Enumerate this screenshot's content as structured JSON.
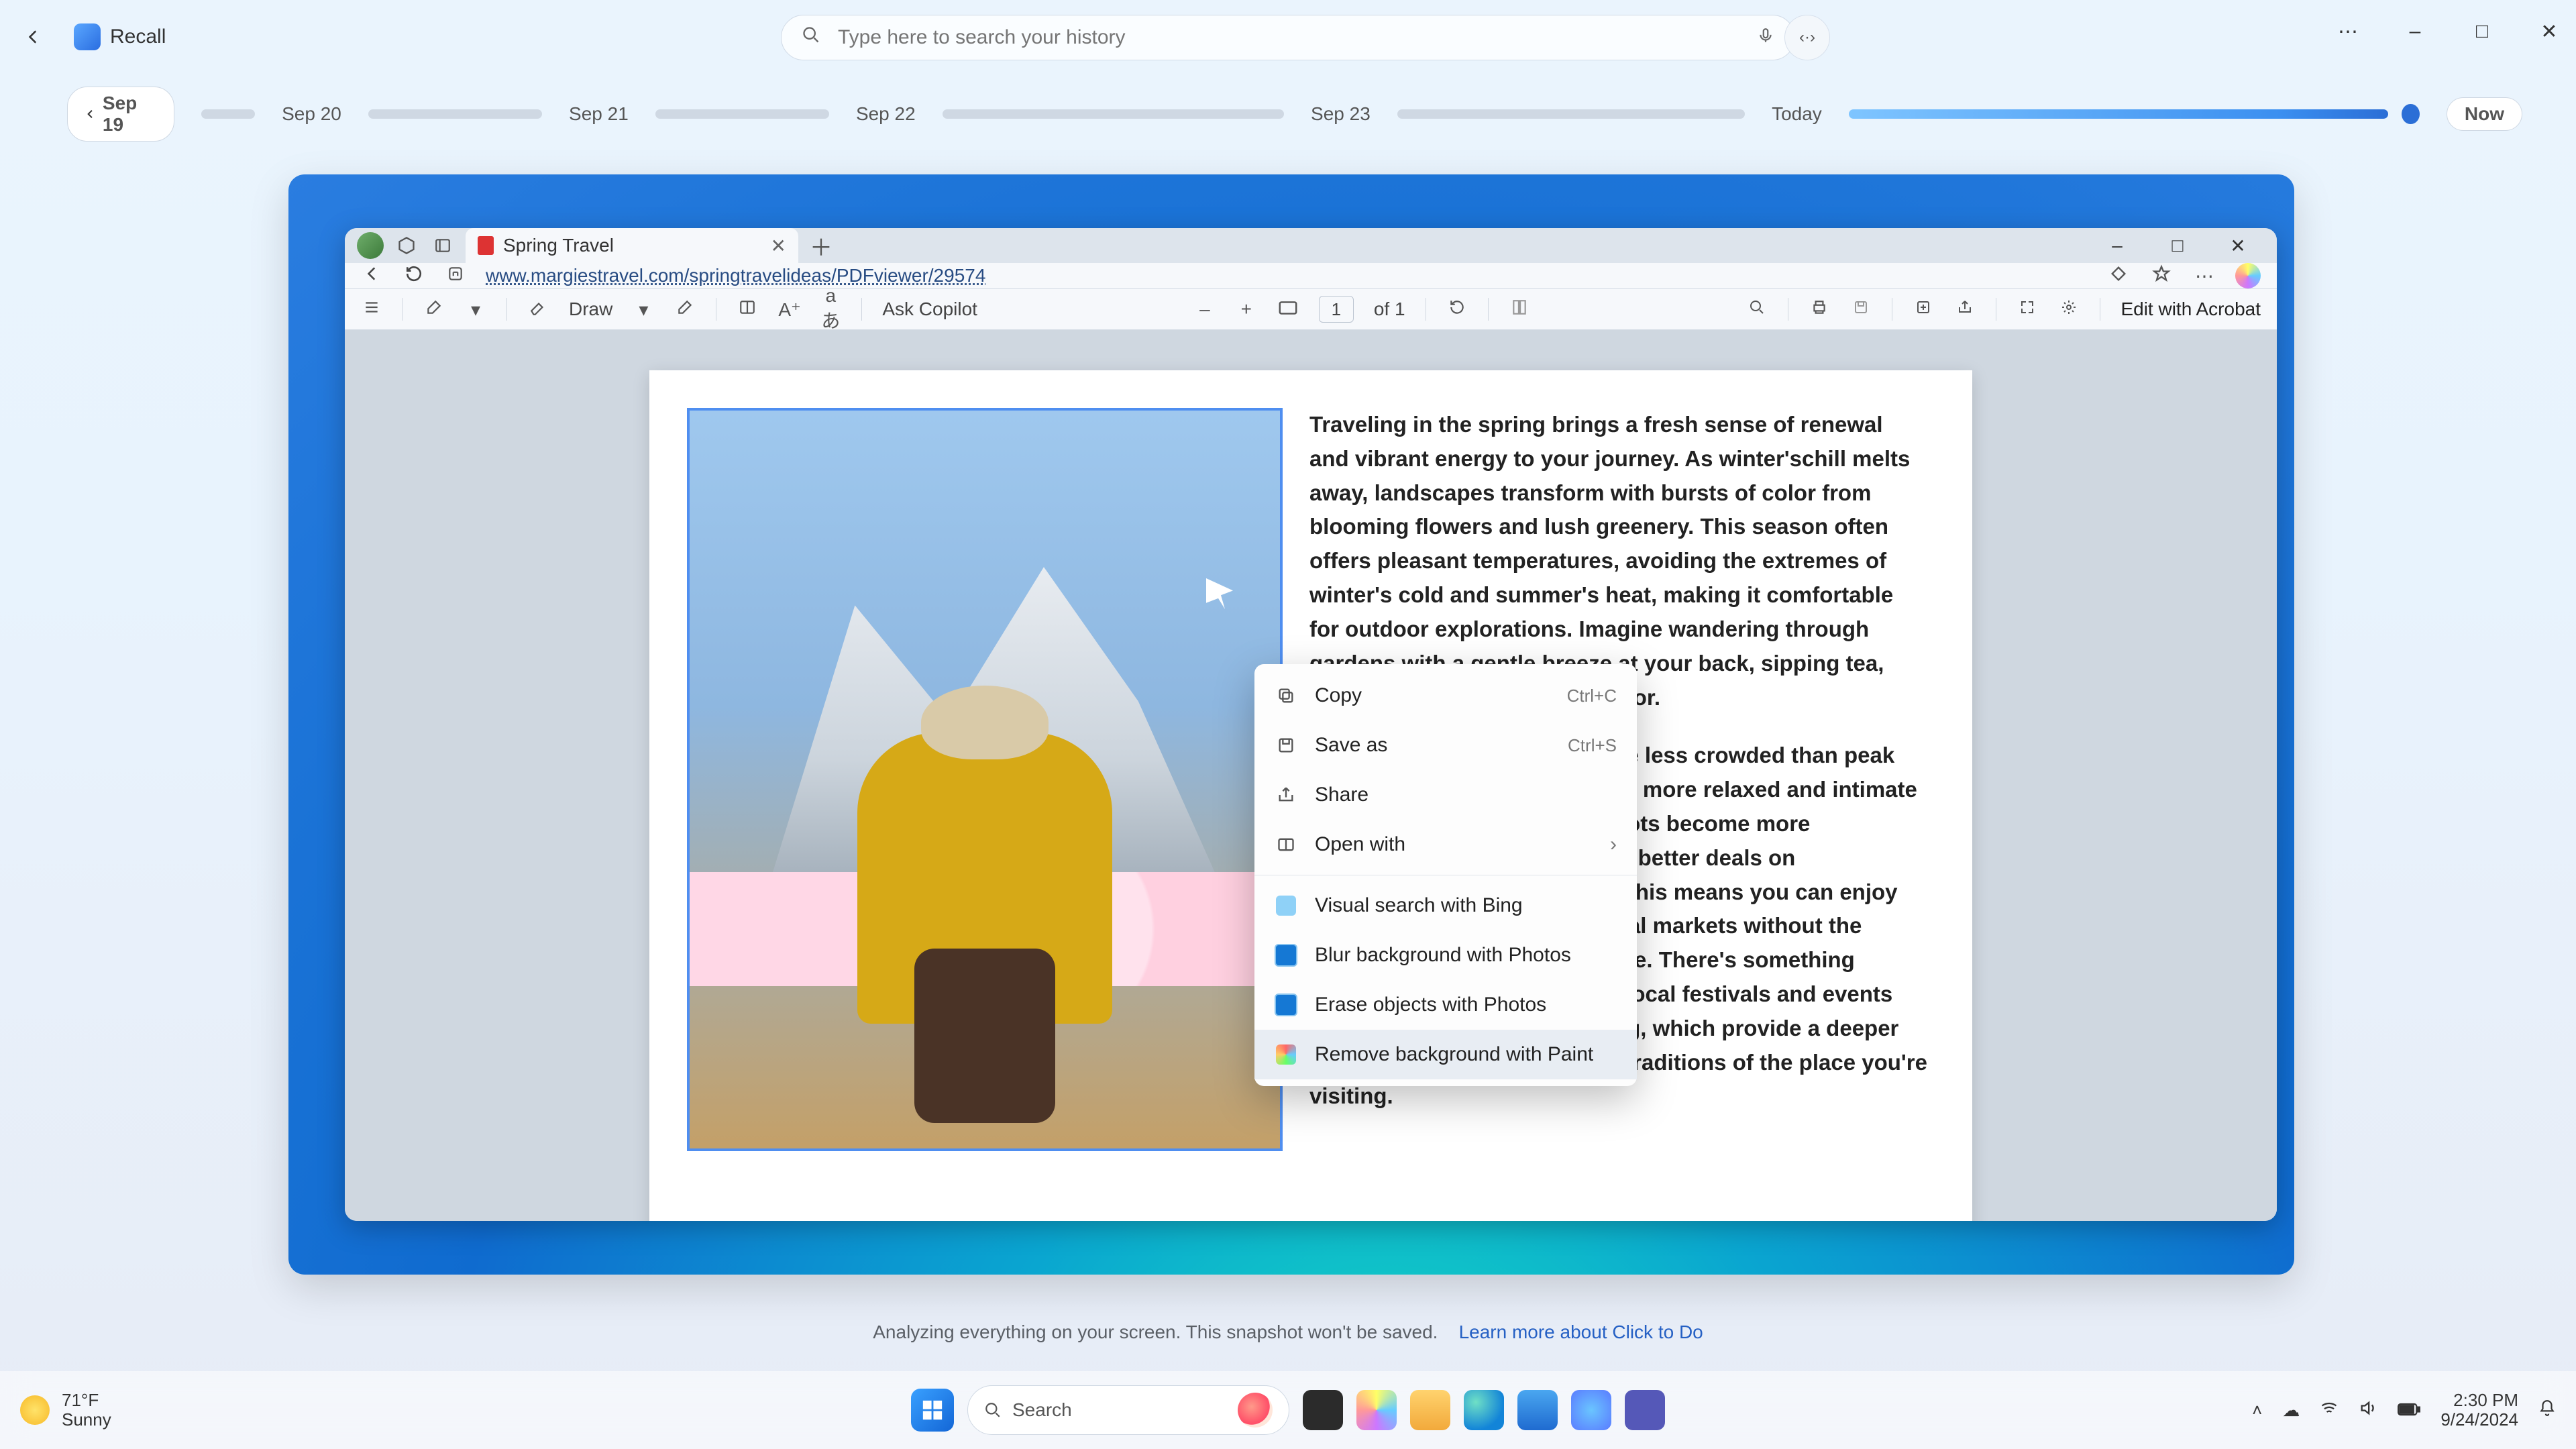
{
  "recall": {
    "app_name": "Recall",
    "search_placeholder": "Type here to search your history",
    "more_icon": "more-horizontal",
    "minimize": "–",
    "maximize": "□",
    "close": "✕"
  },
  "timeline": {
    "back_label": "Sep 19",
    "dates": [
      "Sep 20",
      "Sep 21",
      "Sep 22",
      "Sep 23"
    ],
    "today_label": "Today",
    "now_label": "Now"
  },
  "browser": {
    "tab_title": "Spring Travel",
    "url": "www.margiestravel.com/springtravelideas/PDFviewer/29574",
    "minimize": "–",
    "maximize": "□",
    "close": "✕"
  },
  "pdfbar": {
    "draw_label": "Draw",
    "ask_label": "Ask Copilot",
    "zoom_minus": "–",
    "zoom_plus": "+",
    "page_current": "1",
    "page_total_label": "of 1",
    "edit_label": "Edit with Acrobat"
  },
  "document": {
    "paragraph1": "Traveling in the spring brings a fresh sense of renewal and vibrant energy to your journey. As winter'schill melts away, landscapes transform with bursts of color from blooming flowers and lush greenery. This season often offers pleasant temperatures, avoiding the extremes of winter's cold and summer's heat, making it comfortable for outdoor explorations. Imagine wandering through gardens with a gentle breeze at your back, sipping tea, surrounded by nature's splendor.",
    "paragraph2": "Additionally, spring tends to be less crowded than peak summer months, allowing for a more relaxed and intimate experience. Popular tourist spots become more accessible, and you might find better deals on accommodations and flights. This means you can enjoy attractions, museums, and local markets without the overwhelming hustle and bustle. There's something particularly enchanting about local festivals and events celebrating the arrival of spring, which provide a deeper connection to the culture and traditions of the place you're visiting."
  },
  "context_menu": {
    "copy": "Copy",
    "copy_shortcut": "Ctrl+C",
    "save_as": "Save as",
    "save_shortcut": "Ctrl+S",
    "share": "Share",
    "open_with": "Open with",
    "visual_search": "Visual search with Bing",
    "blur_bg": "Blur background with Photos",
    "erase": "Erase objects with Photos",
    "remove_bg": "Remove background with Paint"
  },
  "footer": {
    "text": "Analyzing everything on your screen. This snapshot won't be saved.",
    "link": "Learn more about Click to Do"
  },
  "taskbar": {
    "temp": "71°F",
    "cond": "Sunny",
    "search_label": "Search",
    "time": "2:30 PM",
    "date": "9/24/2024"
  }
}
